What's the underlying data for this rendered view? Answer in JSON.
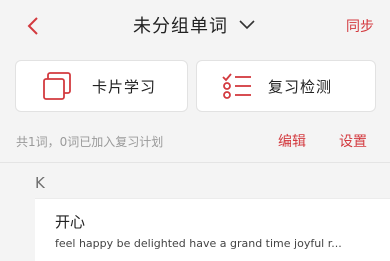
{
  "header": {
    "title": "未分组单词",
    "sync_label": "同步",
    "back_icon": "chevron-left-icon",
    "title_icon": "chevron-down-icon"
  },
  "actions": [
    {
      "label": "卡片学习",
      "icon": "cards-icon"
    },
    {
      "label": "复习检测",
      "icon": "checklist-icon"
    }
  ],
  "summary": {
    "text": "共1词，0词已加入复习计划",
    "edit_label": "编辑",
    "settings_label": "设置"
  },
  "section": {
    "letter": "K"
  },
  "words": [
    {
      "word": "开心",
      "definition": "feel happy be delighted have a grand time joyful r..."
    }
  ],
  "colors": {
    "accent": "#d33a3f",
    "background": "#f4f4f4"
  }
}
